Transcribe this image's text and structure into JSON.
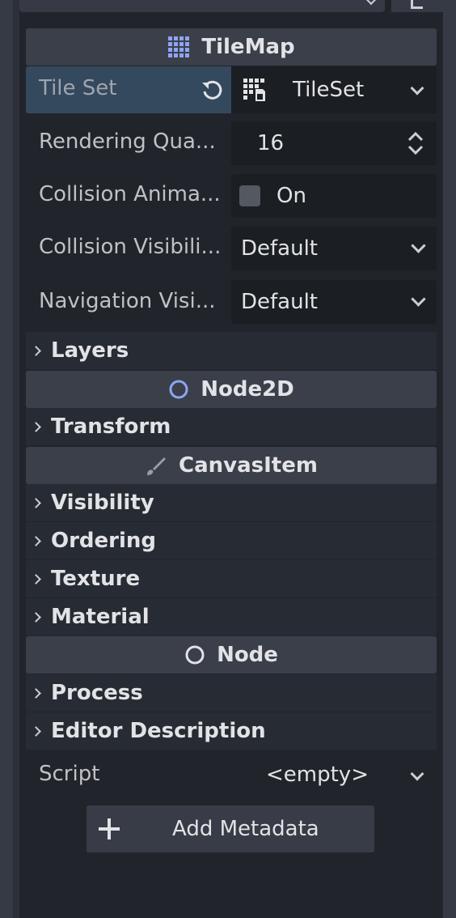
{
  "inspector": {
    "tilemap": {
      "header": "TileMap",
      "tile_set": {
        "label": "Tile Set",
        "value": "TileSet"
      },
      "rendering_quadrant": {
        "label": "Rendering Qua...",
        "value": "16"
      },
      "collision_animatable": {
        "label": "Collision Anima...",
        "value": "On"
      },
      "collision_visibility": {
        "label": "Collision Visibili...",
        "value": "Default"
      },
      "navigation_visibility": {
        "label": "Navigation Visi...",
        "value": "Default"
      },
      "layers_group": "Layers"
    },
    "node2d": {
      "header": "Node2D",
      "transform_group": "Transform"
    },
    "canvas_item": {
      "header": "CanvasItem",
      "groups": [
        "Visibility",
        "Ordering",
        "Texture",
        "Material"
      ]
    },
    "node": {
      "header": "Node",
      "groups": [
        "Process",
        "Editor Description"
      ]
    },
    "script": {
      "label": "Script",
      "value": "<empty>"
    },
    "add_metadata_label": "Add Metadata"
  },
  "colors": {
    "panel_bg": "#21252b",
    "header_bg": "#3b3f4a",
    "selected_row": "#34495e",
    "tilemap_icon": "#8da5f3",
    "node2d_icon": "#8da5f3"
  },
  "icons": [
    "tilemap-icon",
    "reset-icon",
    "tileset-resource-icon",
    "node2d-circle-icon",
    "brush-icon",
    "node-circle-icon",
    "plus-icon"
  ]
}
